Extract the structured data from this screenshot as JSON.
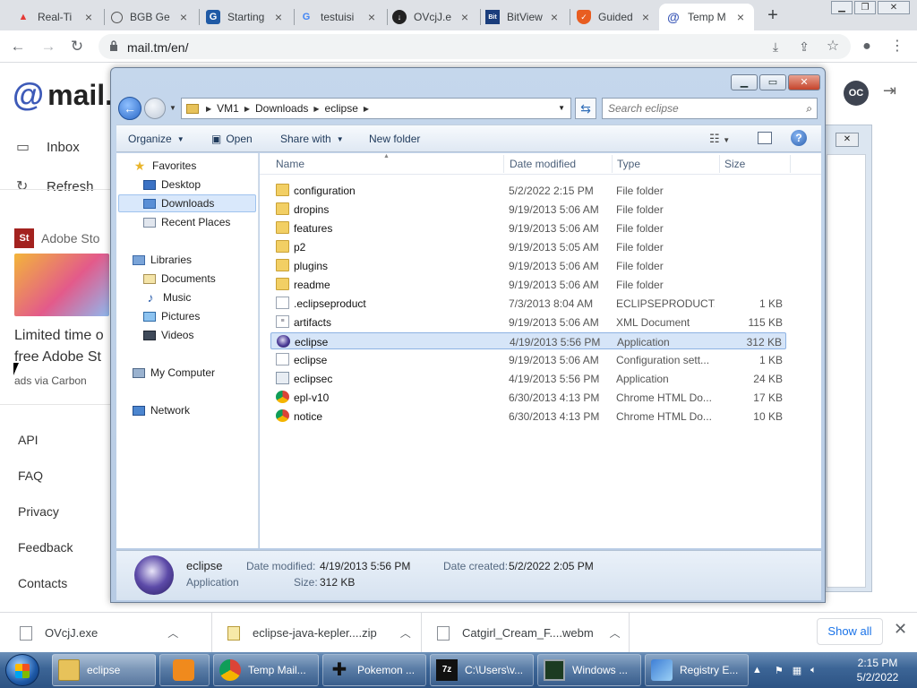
{
  "browser": {
    "tabs": [
      {
        "label": "Real-Ti",
        "icon": "red-triangle-icon"
      },
      {
        "label": "BGB Ge",
        "icon": "globe-icon"
      },
      {
        "label": "Starting",
        "icon": "app-icon"
      },
      {
        "label": "testuisi",
        "icon": "google-icon"
      },
      {
        "label": "OVcjJ.e",
        "icon": "cloud-download-icon"
      },
      {
        "label": "BitView",
        "icon": "bitview-icon"
      },
      {
        "label": "Guided",
        "icon": "shield-icon"
      },
      {
        "label": "Temp M",
        "icon": "mail-at-icon"
      }
    ],
    "url": "mail.tm/en/"
  },
  "mail": {
    "logo_at": "@",
    "logo_text": "mail.",
    "inbox": "Inbox",
    "refresh": "Refresh",
    "ad_brand": "Adobe Sto",
    "ad_brand_badge": "St",
    "ad_text_1": "Limited time o",
    "ad_text_2": "free Adobe St",
    "ad_via": "ads via Carbon",
    "footer": [
      "API",
      "FAQ",
      "Privacy",
      "Feedback",
      "Contacts"
    ],
    "avatar": "OC"
  },
  "explorer": {
    "path": [
      "VM1",
      "Downloads",
      "eclipse"
    ],
    "search_placeholder": "Search eclipse",
    "commands": {
      "organize": "Organize",
      "open": "Open",
      "share": "Share with",
      "new_folder": "New folder"
    },
    "nav": {
      "favorites": "Favorites",
      "desktop": "Desktop",
      "downloads": "Downloads",
      "recent": "Recent Places",
      "libraries": "Libraries",
      "documents": "Documents",
      "music": "Music",
      "pictures": "Pictures",
      "videos": "Videos",
      "computer": "My Computer",
      "network": "Network"
    },
    "columns": {
      "name": "Name",
      "date": "Date modified",
      "type": "Type",
      "size": "Size"
    },
    "files": [
      {
        "name": "configuration",
        "date": "5/2/2022 2:15 PM",
        "type": "File folder",
        "size": "",
        "icon": "folder-icon"
      },
      {
        "name": "dropins",
        "date": "9/19/2013 5:06 AM",
        "type": "File folder",
        "size": "",
        "icon": "folder-icon"
      },
      {
        "name": "features",
        "date": "9/19/2013 5:06 AM",
        "type": "File folder",
        "size": "",
        "icon": "folder-icon"
      },
      {
        "name": "p2",
        "date": "9/19/2013 5:05 AM",
        "type": "File folder",
        "size": "",
        "icon": "folder-icon"
      },
      {
        "name": "plugins",
        "date": "9/19/2013 5:06 AM",
        "type": "File folder",
        "size": "",
        "icon": "folder-icon"
      },
      {
        "name": "readme",
        "date": "9/19/2013 5:06 AM",
        "type": "File folder",
        "size": "",
        "icon": "folder-icon"
      },
      {
        "name": ".eclipseproduct",
        "date": "7/3/2013 8:04 AM",
        "type": "ECLIPSEPRODUCT...",
        "size": "1 KB",
        "icon": "document-icon"
      },
      {
        "name": "artifacts",
        "date": "9/19/2013 5:06 AM",
        "type": "XML Document",
        "size": "115 KB",
        "icon": "xml-file-icon"
      },
      {
        "name": "eclipse",
        "date": "4/19/2013 5:56 PM",
        "type": "Application",
        "size": "312 KB",
        "icon": "eclipse-app-icon",
        "selected": true
      },
      {
        "name": "eclipse",
        "date": "9/19/2013 5:06 AM",
        "type": "Configuration sett...",
        "size": "1 KB",
        "icon": "config-file-icon"
      },
      {
        "name": "eclipsec",
        "date": "4/19/2013 5:56 PM",
        "type": "Application",
        "size": "24 KB",
        "icon": "app-window-icon"
      },
      {
        "name": "epl-v10",
        "date": "6/30/2013 4:13 PM",
        "type": "Chrome HTML Do...",
        "size": "17 KB",
        "icon": "chrome-icon"
      },
      {
        "name": "notice",
        "date": "6/30/2013 4:13 PM",
        "type": "Chrome HTML Do...",
        "size": "10 KB",
        "icon": "chrome-icon"
      }
    ],
    "details": {
      "name": "eclipse",
      "kind": "Application",
      "modified_label": "Date modified:",
      "modified": "4/19/2013 5:56 PM",
      "created_label": "Date created:",
      "created": "5/2/2022 2:05 PM",
      "size_label": "Size:",
      "size": "312 KB"
    }
  },
  "downloads": {
    "items": [
      "OVcjJ.exe",
      "eclipse-java-kepler....zip",
      "Catgirl_Cream_F....webm"
    ],
    "show_all": "Show all"
  },
  "taskbar": {
    "items": [
      {
        "label": "eclipse",
        "icon": "explorer-folder-icon"
      },
      {
        "label": "",
        "icon": "media-player-icon"
      },
      {
        "label": "Temp Mail...",
        "icon": "chrome-icon"
      },
      {
        "label": "Pokemon ...",
        "icon": "gamepad-icon"
      },
      {
        "label": "C:\\Users\\v...",
        "icon": "7zip-icon"
      },
      {
        "label": "Windows ...",
        "icon": "task-manager-icon"
      },
      {
        "label": "Registry E...",
        "icon": "registry-icon"
      }
    ],
    "time": "2:15 PM",
    "date": "5/2/2022"
  }
}
